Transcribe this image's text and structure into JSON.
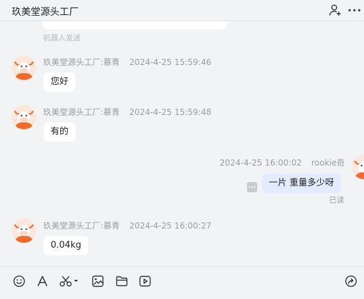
{
  "header": {
    "title": "玖美堂源头工厂",
    "icons": [
      "add-user-icon",
      "more-icon"
    ]
  },
  "prev_message": {
    "meta": "机器人发送"
  },
  "messages": [
    {
      "sender": "玖美堂源头工厂:慕青",
      "time": "2024-4-25 15:59:46",
      "text": "您好",
      "mine": false
    },
    {
      "sender": "玖美堂源头工厂:慕青",
      "time": "2024-4-25 15:59:48",
      "text": "有的",
      "mine": false
    },
    {
      "sender": "rookie奇",
      "time": "2024-4-25 16:00:02",
      "text": "一片  重量多少呀",
      "mine": true,
      "status": "已读"
    },
    {
      "sender": "玖美堂源头工厂:慕青",
      "time": "2024-4-25 16:00:27",
      "text": "0.04kg",
      "mine": false
    }
  ],
  "toolbar": {
    "icons": [
      "emoji-icon",
      "font-icon",
      "scissors-icon",
      "image-icon",
      "folder-icon",
      "video-icon",
      "share-icon"
    ]
  },
  "colors": {
    "mine_bubble": "#e3ecff",
    "avatar_orange": "#f26b2c"
  }
}
